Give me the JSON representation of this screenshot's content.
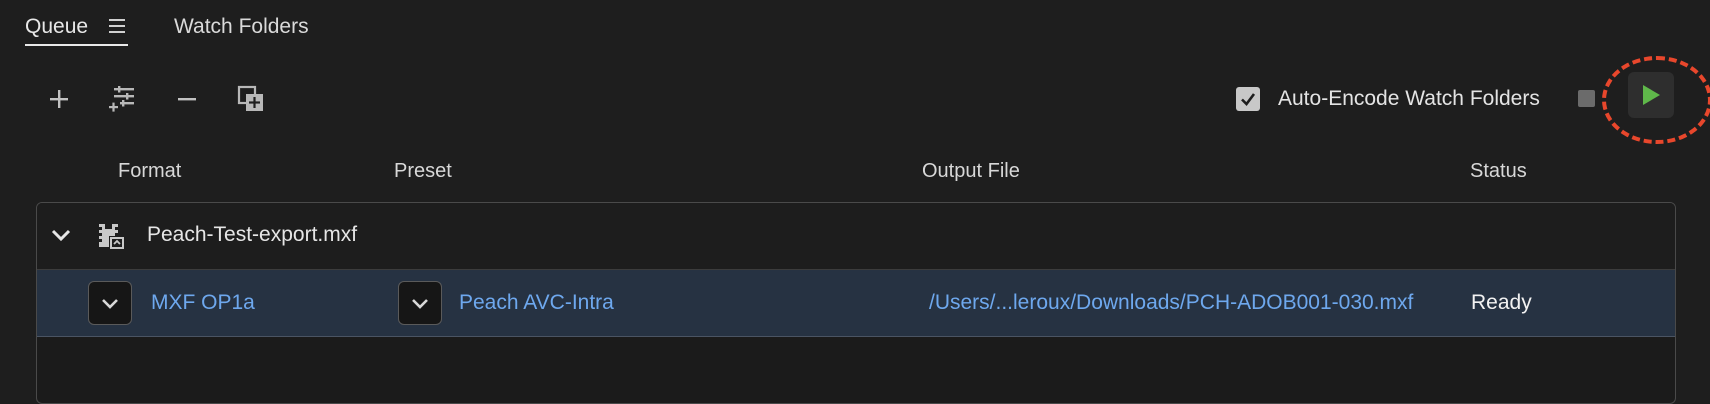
{
  "tabs": {
    "queue_label": "Queue",
    "watch_folders_label": "Watch Folders"
  },
  "toolbar": {
    "auto_encode_label": "Auto-Encode Watch Folders",
    "auto_encode_checked": true,
    "icons": [
      "add-icon",
      "preset-settings-icon",
      "remove-icon",
      "duplicate-icon",
      "stop-icon",
      "play-icon"
    ]
  },
  "columns": {
    "format": "Format",
    "preset": "Preset",
    "output_file": "Output File",
    "status": "Status"
  },
  "queue": {
    "source_name": "Peach-Test-export.mxf",
    "output": {
      "format": "MXF OP1a",
      "preset": "Peach AVC-Intra",
      "output_file": "/Users/...leroux/Downloads/PCH-ADOB001-030.mxf",
      "status": "Ready"
    }
  },
  "colors": {
    "link": "#6ea8ee",
    "play": "#5fb84a",
    "highlight": "#e8472c",
    "selected_row": "#263242"
  }
}
